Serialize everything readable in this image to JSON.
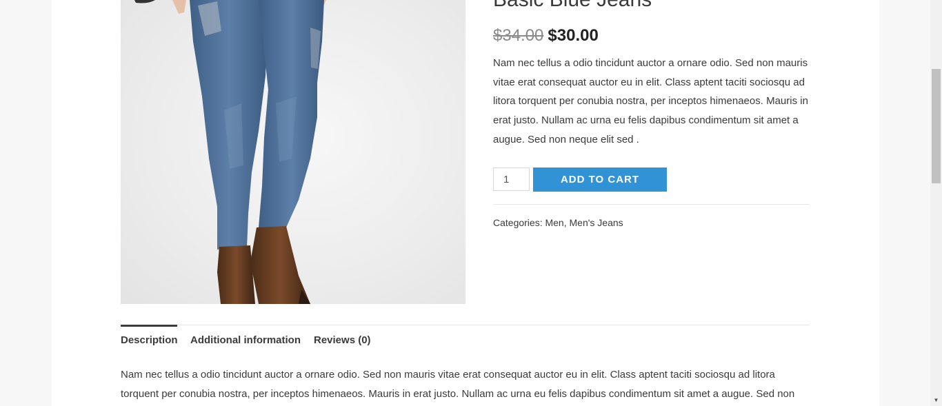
{
  "product": {
    "title": "Basic Blue Jeans",
    "old_price": "$34.00",
    "price": "$30.00",
    "short_description": "Nam nec tellus a odio tincidunt auctor a ornare odio. Sed non mauris vitae erat consequat auctor eu in elit. Class aptent taciti sociosqu ad litora torquent per conubia nostra, per inceptos himenaeos. Mauris in erat justo. Nullam ac urna eu felis dapibus condimentum sit amet a augue. Sed non neque elit sed .",
    "quantity": "1",
    "add_to_cart_label": "ADD TO CART",
    "categories_label": "Categories:",
    "categories": [
      "Men",
      "Men's Jeans"
    ],
    "categories_separator": ", "
  },
  "tabs": [
    {
      "label": "Description",
      "active": true
    },
    {
      "label": "Additional information",
      "active": false
    },
    {
      "label": "Reviews (0)",
      "active": false
    }
  ],
  "description_text": "Nam nec tellus a odio tincidunt auctor a ornare odio. Sed non mauris vitae erat consequat auctor eu in elit. Class aptent taciti sociosqu ad litora torquent per conubia nostra, per inceptos himenaeos. Mauris in erat justo. Nullam ac urna eu felis dapibus condimentum sit amet a augue. Sed non",
  "colors": {
    "accent": "#3292d6",
    "page_background": "#f7f7f7",
    "text": "#3a3a3a"
  },
  "icons": {
    "scroll_down": "scroll-down-arrow-icon"
  }
}
